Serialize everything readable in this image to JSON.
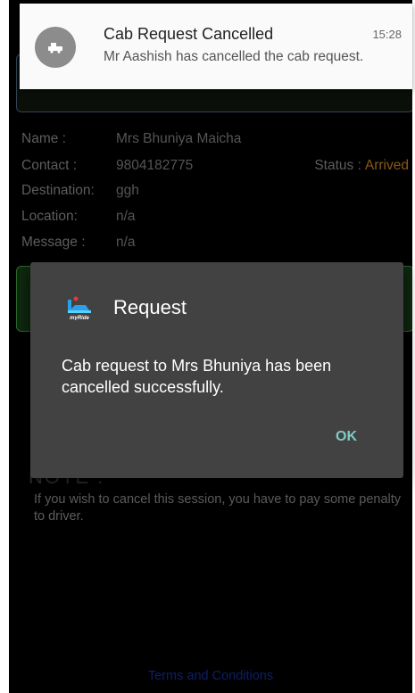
{
  "notification": {
    "title": "Cab Request Cancelled",
    "time": "15:28",
    "body": "Mr Aashish has cancelled the cab request.",
    "icon": "car-icon"
  },
  "details": {
    "name_label": "Name :",
    "name_value": "Mrs Bhuniya Maicha",
    "contact_label": "Contact :",
    "contact_value": "9804182775",
    "status_label": "Status :",
    "status_value": "Arrived",
    "destination_label": "Destination:",
    "destination_value": "ggh",
    "location_label": "Location:",
    "location_value": "n/a",
    "message_label": "Message :",
    "message_value": "n/a"
  },
  "note": {
    "title": "NOTE :",
    "text": "If you wish to cancel this session, you have to pay some penalty  to driver."
  },
  "footer": {
    "terms_link": "Terms and Conditions"
  },
  "dialog": {
    "title": "Request",
    "logo_text": "myRide",
    "message": "Cab request to Mrs Bhuniya has been cancelled successfully.",
    "ok_label": "OK"
  },
  "colors": {
    "dialog_bg": "#424242",
    "ok_accent": "#7fcbc4",
    "status_color": "#8a5a14",
    "terms_color": "#0e1f6b"
  }
}
